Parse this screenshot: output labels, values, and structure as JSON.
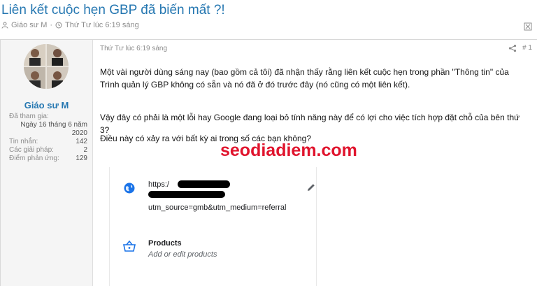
{
  "thread": {
    "title": "Liên kết cuộc hẹn GBP đã biến mất ?!",
    "author": "Giáo sư M",
    "time": "Thứ Tư lúc 6:19 sáng"
  },
  "user": {
    "name": "Giáo sư M",
    "stats": [
      {
        "label": "Đã tham gia:",
        "value": ""
      },
      {
        "label": "",
        "value": "Ngày 16 tháng 6 năm"
      },
      {
        "label": "",
        "value": "2020"
      },
      {
        "label": "Tin nhắn:",
        "value": "142"
      },
      {
        "label": "Các giải pháp:",
        "value": "2"
      },
      {
        "label": "Điểm phản ứng:",
        "value": "129"
      }
    ]
  },
  "post": {
    "time": "Thứ Tư lúc 6:19 sáng",
    "number": "# 1",
    "paragraph1": "Một vài người dùng sáng nay (bao gồm cả tôi) đã nhận thấy rằng liên kết cuộc hẹn trong phần \"Thông tin\" của Trình quản lý GBP không có sẵn và nó đã ở đó trước đây (nó cũng có một liên kết).",
    "paragraph2": "Vậy đây có phải là một lỗi hay Google đang loại bỏ tính năng này để có lợi cho việc tích hợp đặt chỗ của bên thứ 3?",
    "paragraph3": "Điều này có xảy ra với bất kỳ ai trong số các bạn không?"
  },
  "watermark": "seodiadiem.com",
  "card": {
    "url_prefix": "https:/",
    "url_params": "utm_source=gmb&utm_medium=referral",
    "products_title": "Products",
    "products_sub": "Add or edit products"
  }
}
